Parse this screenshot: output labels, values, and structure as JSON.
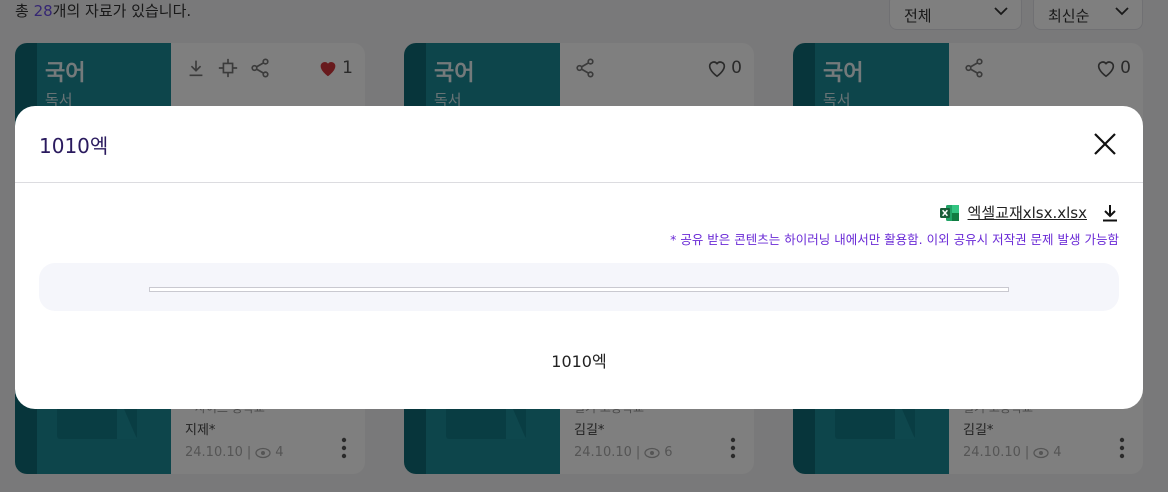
{
  "page": {
    "count_prefix": "총 ",
    "count_number": "28",
    "count_suffix": "개의 자료가 있습니다.",
    "filter_selected": "전체",
    "sort_selected": "최신순"
  },
  "cards": [
    {
      "subject": "국어",
      "subject_sub": "독서",
      "likes": "1",
      "liked": true,
      "meta_faint": "* 사이트 중학교",
      "author": "지제*",
      "date": "24.10.10",
      "views": "4"
    },
    {
      "subject": "국어",
      "subject_sub": "독서",
      "likes": "0",
      "liked": false,
      "meta_faint": "필기 고등학교",
      "author": "김길*",
      "date": "24.10.10",
      "views": "6"
    },
    {
      "subject": "국어",
      "subject_sub": "독서",
      "likes": "0",
      "liked": false,
      "meta_faint": "필기 고등학교",
      "author": "김길*",
      "date": "24.10.10",
      "views": "4"
    }
  ],
  "modal": {
    "title": "1010엑",
    "file_name": "엑셀교재xlsx.xlsx",
    "notice": "* 공유 받은 콘텐츠는 하이러닝 내에서만 활용함. 이외 공유시 저작권 문제 발생 가능함",
    "body_text": "1010엑"
  },
  "colors": {
    "accent": "#6b4de6",
    "notice": "#6a2ad6",
    "card_thumb": "#1a8a96",
    "like_active": "#d0343a"
  },
  "icons": {
    "download": "download-icon",
    "move": "move-icon",
    "share": "share-icon",
    "heart": "heart-icon",
    "close": "close-icon",
    "excel": "excel-icon",
    "eye": "eye-icon",
    "kebab": "kebab-icon",
    "chevron": "chevron-down-icon"
  }
}
